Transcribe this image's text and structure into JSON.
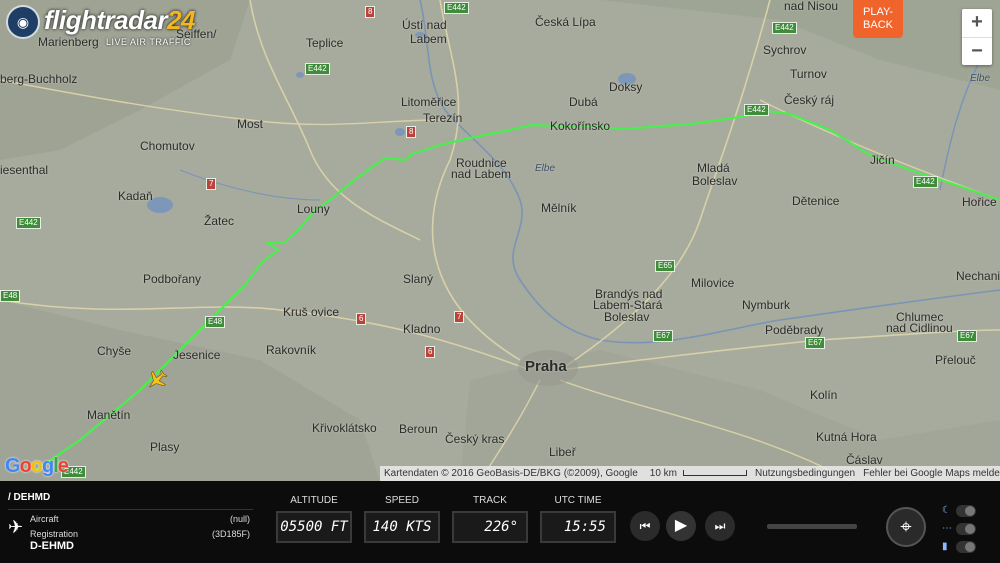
{
  "header": {
    "logo_brand": "flightradar",
    "logo_number": "24",
    "logo_sub": "LIVE AIR TRAFFIC",
    "playback_label_1": "PLAY-",
    "playback_label_2": "BACK"
  },
  "zoom": {
    "in": "+",
    "out": "−"
  },
  "map": {
    "places": [
      {
        "name": "Ústí nad",
        "big": false
      },
      {
        "name": "Labem",
        "big": false
      },
      {
        "name": "Česká Lípa",
        "big": false
      },
      {
        "name": "Teplice",
        "big": false
      },
      {
        "name": "Most",
        "big": false
      },
      {
        "name": "Litoměřice",
        "big": false
      },
      {
        "name": "Terezín",
        "big": false
      },
      {
        "name": "Dubá",
        "big": false
      },
      {
        "name": "Doksy",
        "big": false
      },
      {
        "name": "Sychrov",
        "big": false
      },
      {
        "name": "Turnov",
        "big": false
      },
      {
        "name": "Český ráj",
        "big": false
      },
      {
        "name": "Chomutov",
        "big": false
      },
      {
        "name": "Roudnice",
        "big": false
      },
      {
        "name": "nad Labem",
        "big": false
      },
      {
        "name": "Kokořínsko",
        "big": false
      },
      {
        "name": "Mladá",
        "big": false
      },
      {
        "name": "Boleslav",
        "big": false
      },
      {
        "name": "Jičín",
        "big": false
      },
      {
        "name": "Kadaň",
        "big": false
      },
      {
        "name": "Žatec",
        "big": false
      },
      {
        "name": "Louny",
        "big": false
      },
      {
        "name": "Mělník",
        "big": false
      },
      {
        "name": "Dětenice",
        "big": false
      },
      {
        "name": "Hořice",
        "big": false
      },
      {
        "name": "Podbořany",
        "big": false
      },
      {
        "name": "Slaný",
        "big": false
      },
      {
        "name": "Milovice",
        "big": false
      },
      {
        "name": "Nechanice",
        "big": false
      },
      {
        "name": "Brandýs nad",
        "big": false
      },
      {
        "name": "Labem-Stará",
        "big": false
      },
      {
        "name": "Boleslav",
        "big": false
      },
      {
        "name": "Kruš ovice",
        "big": false
      },
      {
        "name": "Nymburk",
        "big": false
      },
      {
        "name": "Chlumec",
        "big": false
      },
      {
        "name": "nad Cidlinou",
        "big": false
      },
      {
        "name": "Kladno",
        "big": false
      },
      {
        "name": "Poděbrady",
        "big": false
      },
      {
        "name": "Rakovník",
        "big": false
      },
      {
        "name": "Chyše",
        "big": false
      },
      {
        "name": "Jesenice",
        "big": false
      },
      {
        "name": "Praha",
        "big": true
      },
      {
        "name": "Přelouč",
        "big": false
      },
      {
        "name": "Manětín",
        "big": false
      },
      {
        "name": "Křivoklátsko",
        "big": false
      },
      {
        "name": "Beroun",
        "big": false
      },
      {
        "name": "Kolín",
        "big": false
      },
      {
        "name": "Český kras",
        "big": false
      },
      {
        "name": "Plasy",
        "big": false
      },
      {
        "name": "Kutná Hora",
        "big": false
      },
      {
        "name": "Libeř",
        "big": false
      },
      {
        "name": "Čáslav",
        "big": false
      },
      {
        "name": "Marienberg",
        "big": false
      },
      {
        "name": "berg-Buchholz",
        "big": false
      },
      {
        "name": "iesenthal",
        "big": false
      },
      {
        "name": "Seiffen/",
        "big": false
      },
      {
        "name": "nad Nisou",
        "big": false
      },
      {
        "name": "Elbe",
        "big": false
      },
      {
        "name": "Elbe",
        "big": false
      }
    ],
    "roads": [
      {
        "label": "E442",
        "red": false
      },
      {
        "label": "8",
        "red": true
      },
      {
        "label": "E442",
        "red": false
      },
      {
        "label": "E442",
        "red": false
      },
      {
        "label": "8",
        "red": true
      },
      {
        "label": "E442",
        "red": false
      },
      {
        "label": "7",
        "red": true
      },
      {
        "label": "E442",
        "red": false
      },
      {
        "label": "E65",
        "red": false
      },
      {
        "label": "E48",
        "red": false
      },
      {
        "label": "6",
        "red": true
      },
      {
        "label": "7",
        "red": true
      },
      {
        "label": "6",
        "red": true
      },
      {
        "label": "E67",
        "red": false
      },
      {
        "label": "E67",
        "red": false
      },
      {
        "label": "E67",
        "red": false
      },
      {
        "label": "E442",
        "red": false
      },
      {
        "label": "E48",
        "red": false
      },
      {
        "label": "E442",
        "red": false
      }
    ],
    "google_logo": "Google",
    "attribution": "Kartendaten © 2016 GeoBasis-DE/BKG (©2009), Google",
    "scale_label": "10 km",
    "terms": "Nutzungsbedingungen",
    "report": "Fehler bei Google Maps melden",
    "track_color": "#49ef4d"
  },
  "panel": {
    "flight_id": "/ DEHMD",
    "aircraft_label": "Aircraft",
    "aircraft_value": "(null)",
    "registration_label": "Registration",
    "registration_code": "(3D185F)",
    "registration_value": "D-EHMD",
    "gauges": [
      {
        "label": "ALTITUDE",
        "value": "05500 FT"
      },
      {
        "label": "SPEED",
        "value": "140 KTS"
      },
      {
        "label": "TRACK",
        "value": "226°"
      },
      {
        "label": "UTC TIME",
        "value": "15:55"
      }
    ],
    "controls": {
      "rewind": "⏮",
      "play": "▶",
      "forward": "⏭",
      "locate": "⌖"
    }
  }
}
